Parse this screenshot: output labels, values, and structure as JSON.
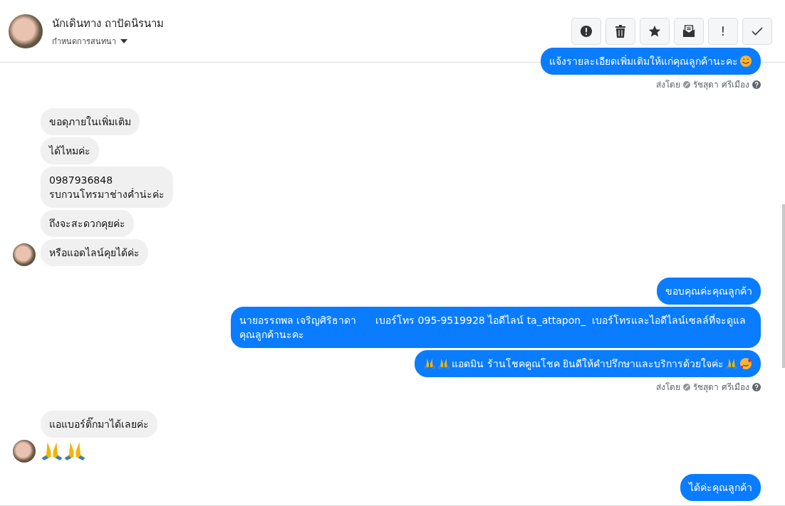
{
  "header": {
    "name": "นักเดินทาง ถาปัดนิรนาม",
    "subtitle": "กำหนดการสนทนา",
    "actions": [
      {
        "kind": "alert"
      },
      {
        "kind": "trash"
      },
      {
        "kind": "star"
      },
      {
        "kind": "envelope"
      },
      {
        "kind": "text",
        "text": "!"
      },
      {
        "kind": "check"
      }
    ]
  },
  "messages": [
    {
      "kind": "out",
      "text": "แจ้งรายละเอียดเพิ่มเติมให้แก่คุณลูกค้านะคะ",
      "icons_after": [
        {
          "kind": "smile"
        }
      ]
    },
    {
      "kind": "sent_by",
      "label": "ส่งโดย",
      "sender": "รัชสุดา ศรีเมือง"
    },
    {
      "kind": "in",
      "text": "ขอดุภายในเพิ่มเติม",
      "avatar": false
    },
    {
      "kind": "in",
      "text": "ได้ไหมค่ะ",
      "avatar": false
    },
    {
      "kind": "in",
      "text": "0987936848\nรบกวนโทรมาช่างค่ำน่ะค่ะ",
      "avatar": false
    },
    {
      "kind": "in",
      "text": "ถึงจะสะดวกคุยค่ะ",
      "avatar": false
    },
    {
      "kind": "in",
      "text": "หรือแอดไลน์คุยได้ค่ะ",
      "avatar": true
    },
    {
      "kind": "out",
      "text": "ขอบคุณค่ะคุณลูกค้า"
    },
    {
      "kind": "out",
      "text": "นายอรรถพล เจริญศิริธาดา      เบอร์โทร 095-9519928 ไอดีไลน์ ta_attapon_  เบอร์โทรและไอดีไลน์เซลล์ที่จะดูแลคุณลูกค้านะคะ"
    },
    {
      "kind": "out",
      "text": "แอดมิน ร้านโชคคูณโชค ยินดีให้คำปรึกษาและบริการด้วยใจค่ะ",
      "icons_before": [
        {
          "kind": "pray"
        },
        {
          "kind": "pray"
        }
      ],
      "icons_after": [
        {
          "kind": "pray"
        },
        {
          "kind": "love"
        }
      ]
    },
    {
      "kind": "sent_by",
      "label": "ส่งโดย",
      "sender": "รัชสุดา ศรีเมือง"
    },
    {
      "kind": "in",
      "text": "แอแบอร์ติ๊กมาได้เลยค่ะ",
      "avatar": false
    },
    {
      "kind": "in_emoji",
      "icons": [
        {
          "kind": "pray"
        },
        {
          "kind": "pray"
        }
      ],
      "avatar": true
    },
    {
      "kind": "out",
      "text": "ได้ค่ะคุณลูกค้า"
    }
  ]
}
